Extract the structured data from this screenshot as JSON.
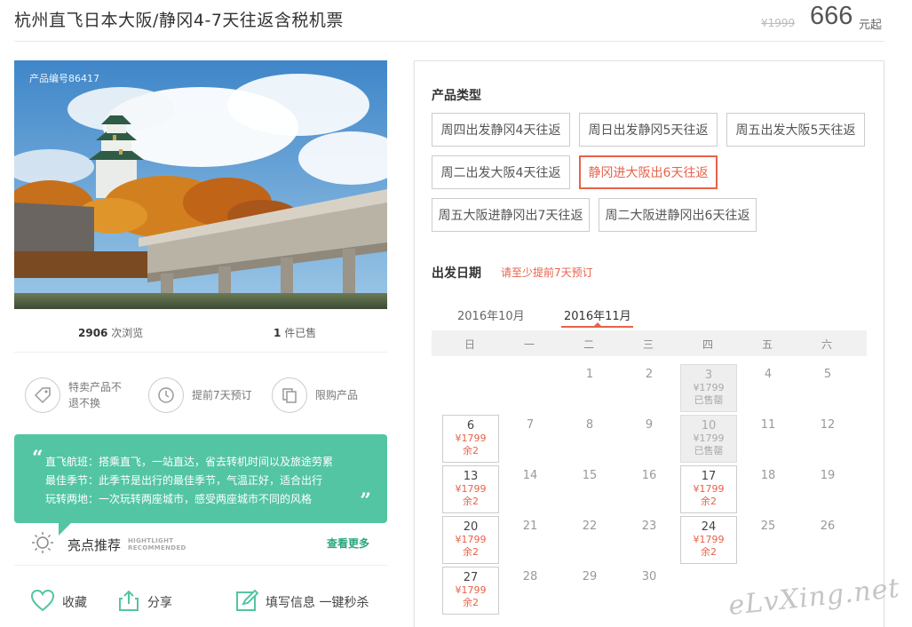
{
  "header": {
    "title": "杭州直飞日本大阪/静冈4-7天往返含税机票",
    "original_price": "¥1999",
    "price": "666",
    "price_unit": "元起"
  },
  "product": {
    "product_no": "产品编号86417",
    "views_count": "2906",
    "views_label": "次浏览",
    "sold_count": "1",
    "sold_label": "件已售"
  },
  "features": [
    {
      "icon": "tag-icon",
      "text": "特卖产品不退不换"
    },
    {
      "icon": "clock-icon",
      "text": "提前7天预订"
    },
    {
      "icon": "copy-icon",
      "text": "限购产品"
    }
  ],
  "highlights": {
    "lines": [
      "直飞航班：搭乘直飞，一站直达，省去转机时间以及旅途劳累",
      "最佳季节：此季节是出行的最佳季节，气温正好，适合出行",
      "玩转两地：一次玩转两座城市，感受两座城市不同的风格"
    ],
    "title": "亮点推荐",
    "sub_line1": "HIGHTLIGHT",
    "sub_line2": "RECOMMENDED",
    "see_more": "查看更多"
  },
  "actions": [
    {
      "icon": "heart-icon",
      "label": "收藏"
    },
    {
      "icon": "share-icon",
      "label": "分享"
    },
    {
      "icon": "edit-icon",
      "label": "填写信息 一键秒杀"
    }
  ],
  "panel": {
    "product_type_label": "产品类型",
    "types": [
      {
        "label": "周四出发静冈4天往返",
        "active": false
      },
      {
        "label": "周日出发静冈5天往返",
        "active": false
      },
      {
        "label": "周五出发大阪5天往返",
        "active": false
      },
      {
        "label": "周二出发大阪4天往返",
        "active": false
      },
      {
        "label": "静冈进大阪出6天往返",
        "active": true
      },
      {
        "label": "周五大阪进静冈出7天往返",
        "active": false
      },
      {
        "label": "周二大阪进静冈出6天往返",
        "active": false
      }
    ],
    "date_label": "出发日期",
    "date_note": "请至少提前7天预订",
    "months": [
      "2016年10月",
      "2016年11月"
    ],
    "active_month": "2016年11月",
    "weekdays": [
      "日",
      "一",
      "二",
      "三",
      "四",
      "五",
      "六"
    ],
    "days": [
      {
        "n": "1",
        "state": "plain"
      },
      {
        "n": "2",
        "state": "plain"
      },
      {
        "n": "3",
        "state": "soldout",
        "price": "¥1799",
        "status": "已售罄"
      },
      {
        "n": "4",
        "state": "plain"
      },
      {
        "n": "5",
        "state": "plain"
      },
      {
        "n": "6",
        "state": "avail",
        "price": "¥1799",
        "status": "余2"
      },
      {
        "n": "7",
        "state": "plain"
      },
      {
        "n": "8",
        "state": "plain"
      },
      {
        "n": "9",
        "state": "plain"
      },
      {
        "n": "10",
        "state": "soldout",
        "price": "¥1799",
        "status": "已售罄"
      },
      {
        "n": "11",
        "state": "plain"
      },
      {
        "n": "12",
        "state": "plain"
      },
      {
        "n": "13",
        "state": "avail",
        "price": "¥1799",
        "status": "余2"
      },
      {
        "n": "14",
        "state": "plain"
      },
      {
        "n": "15",
        "state": "plain"
      },
      {
        "n": "16",
        "state": "plain"
      },
      {
        "n": "17",
        "state": "avail",
        "price": "¥1799",
        "status": "余2"
      },
      {
        "n": "18",
        "state": "plain"
      },
      {
        "n": "19",
        "state": "plain"
      },
      {
        "n": "20",
        "state": "avail",
        "price": "¥1799",
        "status": "余2"
      },
      {
        "n": "21",
        "state": "plain"
      },
      {
        "n": "22",
        "state": "plain"
      },
      {
        "n": "23",
        "state": "plain"
      },
      {
        "n": "24",
        "state": "avail",
        "price": "¥1799",
        "status": "余2"
      },
      {
        "n": "25",
        "state": "plain"
      },
      {
        "n": "26",
        "state": "plain"
      },
      {
        "n": "27",
        "state": "avail",
        "price": "¥1799",
        "status": "余2"
      },
      {
        "n": "28",
        "state": "plain"
      },
      {
        "n": "29",
        "state": "plain"
      },
      {
        "n": "30",
        "state": "plain"
      }
    ]
  },
  "watermark": "eLvXing.net",
  "colors": {
    "accent": "#e8624a",
    "green": "#53c5a2",
    "link_green": "#2aa67e"
  }
}
